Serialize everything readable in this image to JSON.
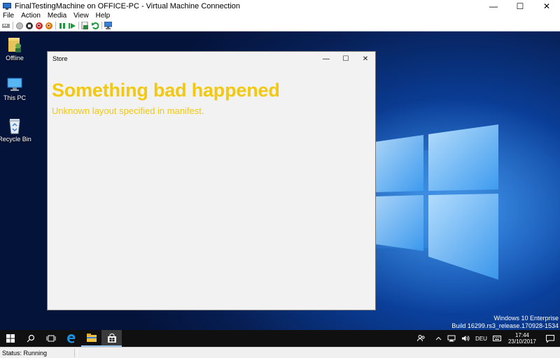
{
  "host": {
    "title": "FinalTestingMachine on OFFICE-PC - Virtual Machine Connection",
    "controls": {
      "minimize": "—",
      "maximize": "☐",
      "close": "✕"
    },
    "menu": [
      "File",
      "Action",
      "Media",
      "View",
      "Help"
    ],
    "status": "Status: Running"
  },
  "desktop": {
    "icons": [
      {
        "label": "Offline"
      },
      {
        "label": "This PC"
      },
      {
        "label": "Recycle Bin"
      }
    ],
    "edition_line1": "Windows 10 Enterprise",
    "edition_line2": "Build 16299.rs3_release.170928-1534"
  },
  "store": {
    "title": "Store",
    "controls": {
      "minimize": "—",
      "maximize": "☐",
      "close": "✕"
    },
    "error_title": "Something bad happened",
    "error_message": "Unknown layout specified in manifest."
  },
  "taskbar": {
    "language": "DEU",
    "time": "17:44",
    "date": "23/10/2017"
  },
  "colors": {
    "error_accent": "#f2c811",
    "desktop_blue": "#0a5fd0",
    "taskbar": "#101010"
  }
}
